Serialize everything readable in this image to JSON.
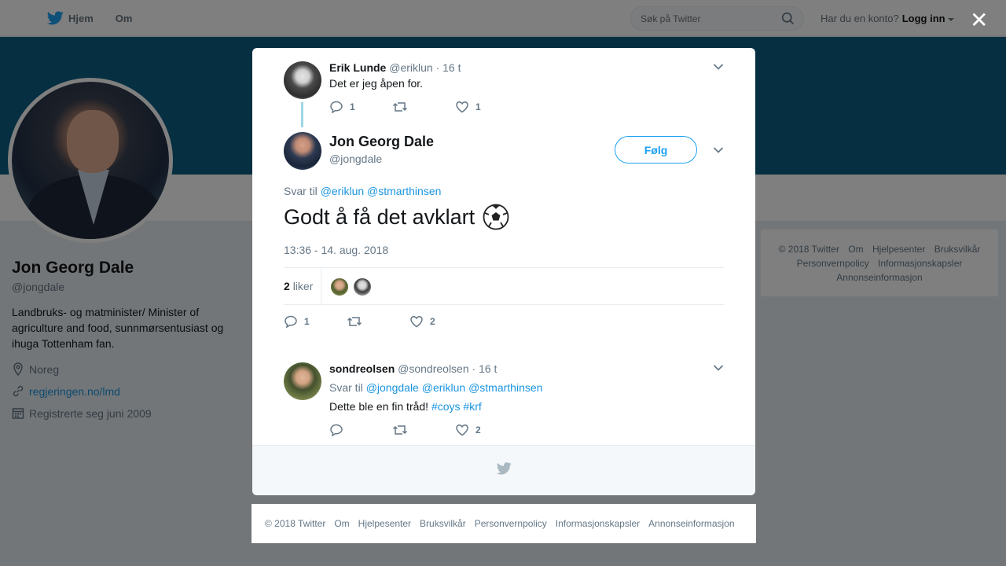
{
  "topbar": {
    "nav": [
      {
        "label": "Hjem"
      },
      {
        "label": "Om"
      }
    ],
    "search_placeholder": "Søk på Twitter",
    "account_prompt": "Har du en konto?",
    "login_label": "Logg inn"
  },
  "profile": {
    "name": "Jon Georg Dale",
    "handle": "@jongdale",
    "bio": "Landbruks- og matminister/ Minister of agriculture and food, sunnmørsentusiast og ihuga Tottenham fan.",
    "location": "Noreg",
    "website": "regjeringen.no/lmd",
    "joined": "Registrerte seg juni 2009"
  },
  "side_footer": {
    "links": [
      "© 2018 Twitter",
      "Om",
      "Hjelpesenter",
      "Bruksvilkår",
      "Personvernpolicy",
      "Informasjonskapsler",
      "Annonseinformasjon"
    ]
  },
  "modal": {
    "parent_tweet": {
      "name": "Erik Lunde",
      "handle": "@eriklun",
      "time": "· 16 t",
      "text": "Det er jeg åpen for.",
      "replies": "1",
      "likes": "1"
    },
    "main_tweet": {
      "name": "Jon Georg Dale",
      "handle": "@jongdale",
      "follow_label": "Følg",
      "reply_prefix": "Svar til",
      "reply_mentions": "@eriklun @stmarthinsen",
      "text": "Godt å få det avklart",
      "timestamp": "13:36 - 14. aug. 2018",
      "likes_count": "2",
      "likes_label": "liker",
      "replies": "1",
      "likes": "2"
    },
    "reply_tweet": {
      "name": "sondreolsen",
      "handle": "@sondreolsen",
      "time": "· 16 t",
      "reply_prefix": "Svar til",
      "reply_mentions": "@jongdale @eriklun @stmarthinsen",
      "text": "Dette ble en fin tråd!",
      "hashtags": "#coys #krf",
      "likes": "2"
    }
  },
  "footer": {
    "links": [
      "© 2018 Twitter",
      "Om",
      "Hjelpesenter",
      "Bruksvilkår",
      "Personvernpolicy",
      "Informasjonskapsler",
      "Annonseinformasjon"
    ]
  },
  "colors": {
    "brand": "#1da1f2",
    "link": "#1b95e0",
    "banner": "#0c5e82",
    "muted": "#657786"
  }
}
